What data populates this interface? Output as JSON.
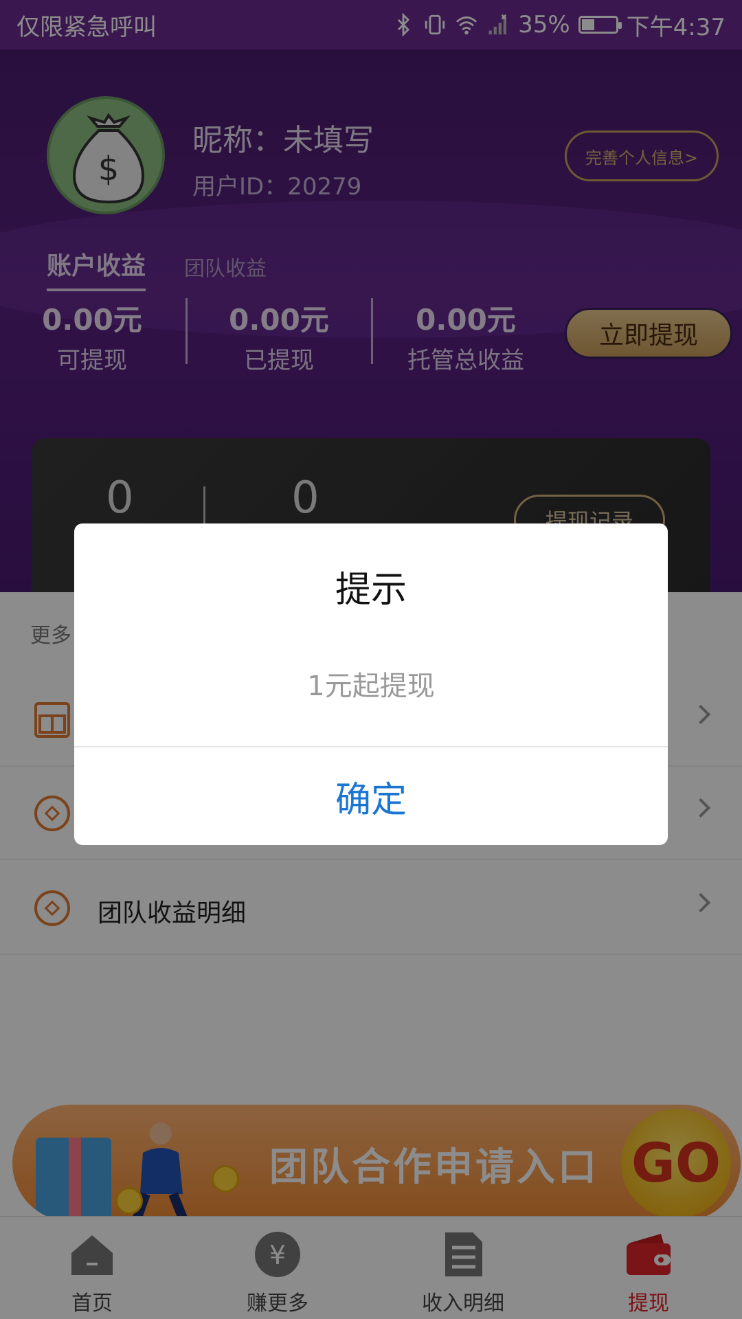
{
  "status_bar": {
    "carrier": "仅限紧急呼叫",
    "battery": "35%",
    "time": "下午4:37",
    "icons": [
      "bluetooth-icon",
      "vibrate-icon",
      "wifi-icon",
      "signal-icon",
      "battery-icon"
    ]
  },
  "profile": {
    "nickname": "昵称：未填写",
    "user_id": "用户ID：20279",
    "complete_button": "完善个人信息>",
    "avatar_icon": "money-bag-icon"
  },
  "tabs": {
    "active": "账户收益",
    "inactive": "团队收益"
  },
  "stats": [
    {
      "value": "0.00元",
      "label": "可提现"
    },
    {
      "value": "0.00元",
      "label": "已提现"
    },
    {
      "value": "0.00元",
      "label": "托管总收益"
    }
  ],
  "withdraw_button": "立即提现",
  "dark_card": {
    "left_value": "0",
    "right_value": "0",
    "record_button": "提现记录"
  },
  "more_section": {
    "title": "更多",
    "items": [
      {
        "label": "",
        "icon": "gift-icon"
      },
      {
        "label": "",
        "icon": "coin-icon"
      },
      {
        "label": "团队收益明细",
        "icon": "coin-icon"
      }
    ]
  },
  "banner": {
    "text": "团队合作申请入口",
    "go": "GO"
  },
  "bottom_nav": [
    {
      "label": "首页",
      "icon": "home-icon"
    },
    {
      "label": "赚更多",
      "icon": "yuan-coin-icon"
    },
    {
      "label": "收入明细",
      "icon": "document-icon"
    },
    {
      "label": "提现",
      "icon": "wallet-icon"
    }
  ],
  "dialog": {
    "title": "提示",
    "message": "1元起提现",
    "confirm": "确定"
  },
  "colors": {
    "purple_header": "#5a2182",
    "accent_gold": "#c9a45a",
    "active_nav": "#e0262a",
    "dialog_button": "#1a76d2"
  }
}
